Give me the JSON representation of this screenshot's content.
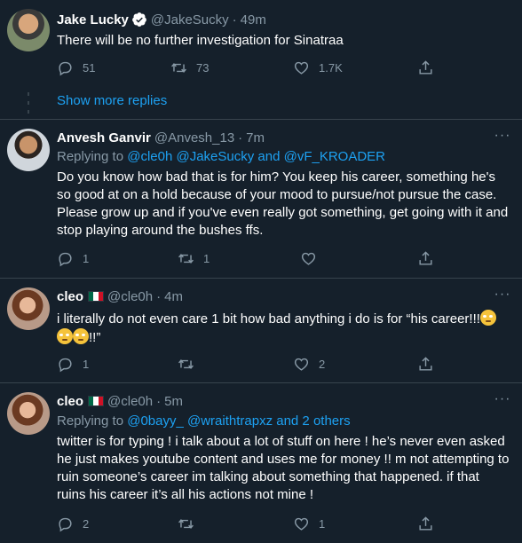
{
  "tweets": [
    {
      "name": "Jake Lucky",
      "handle": "@JakeSucky",
      "time": "49m",
      "text": "There will be no further investigation for Sinatraa",
      "replies": "51",
      "retweets": "73",
      "likes": "1.7K"
    },
    {
      "name": "Anvesh Ganvir",
      "handle": "@Anvesh_13",
      "time": "7m",
      "replying_prefix": "Replying to",
      "replying_to": "@cle0h @JakeSucky and @vF_KROADER",
      "text": "Do you know how bad that is for him? You keep his career, something he's so good at on a hold because of your mood to pursue/not pursue the case. Please grow up and if you've even really got something, get going with it and stop playing around the bushes ffs.",
      "replies": "1",
      "retweets": "1",
      "likes": ""
    },
    {
      "name": "cleo",
      "handle": "@cle0h",
      "time": "4m",
      "text_a": "i literally do not even care 1 bit how bad anything i do is for “his career!!!",
      "text_b": "!!”",
      "replies": "1",
      "retweets": "",
      "likes": "2"
    },
    {
      "name": "cleo",
      "handle": "@cle0h",
      "time": "5m",
      "replying_prefix": "Replying to",
      "replying_to": "@0bayy_ @wraithtrapxz and 2 others",
      "text": "twitter is for typing ! i talk about a lot of stuff on here ! he’s never even asked he just makes youtube content and uses me for money !! m not attempting to ruin someone’s career im talking about something that happened. if that ruins his career it’s all his actions not mine !",
      "replies": "2",
      "retweets": "",
      "likes": "1"
    }
  ],
  "show_more_replies": "Show more replies",
  "colors": {
    "background": "#15202b",
    "text_secondary": "#8899a6",
    "accent": "#1da1f2",
    "divider": "#38444d"
  },
  "icons": [
    "reply-icon",
    "retweet-icon",
    "like-icon",
    "share-icon",
    "verified-icon",
    "more-icon",
    "mexico-flag-icon"
  ]
}
